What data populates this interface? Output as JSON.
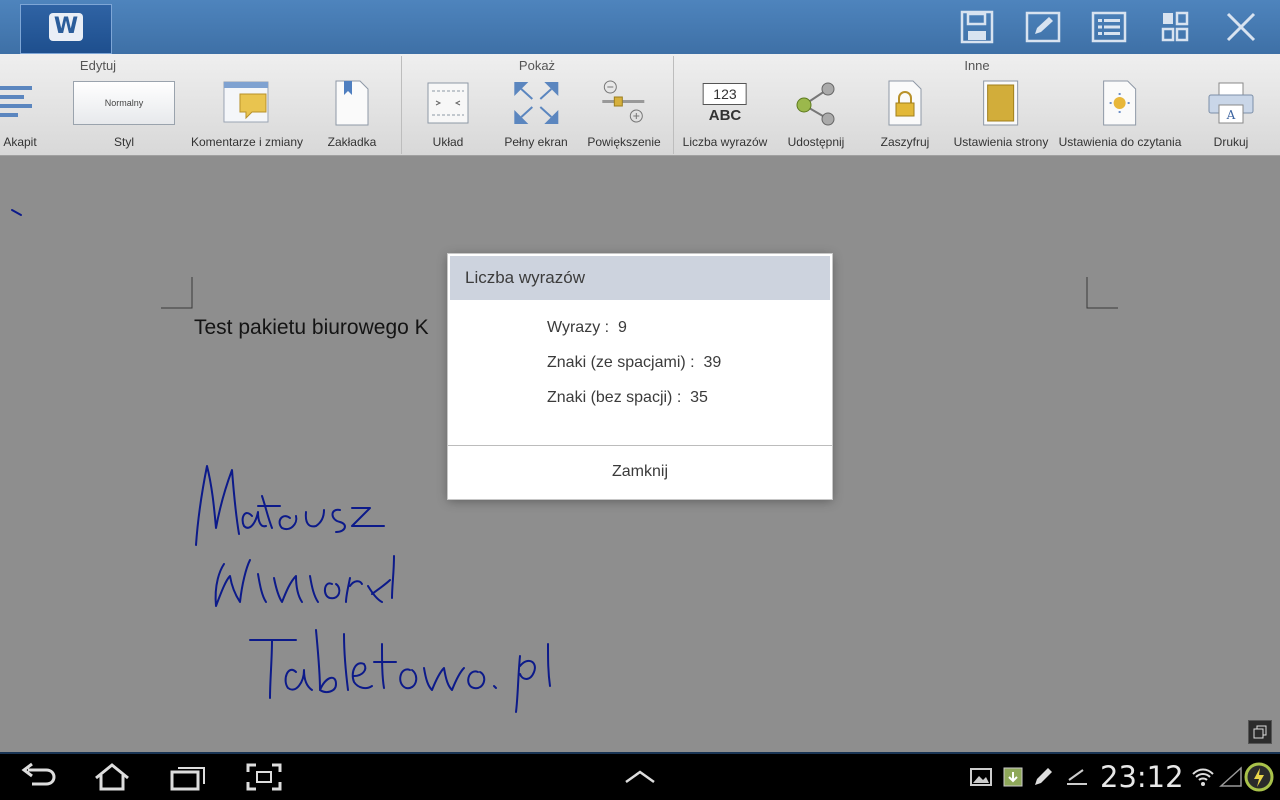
{
  "app_bar": {
    "logo_letter": "W",
    "actions": [
      "save-icon",
      "edit-icon",
      "list-icon",
      "grid-icon",
      "close-icon"
    ]
  },
  "ribbon": {
    "groups": {
      "edit": "Edytuj",
      "show": "Pokaż",
      "other": "Inne"
    },
    "items": {
      "paragraph": "Akapit",
      "style": "Styl",
      "style_value": "Normalny",
      "comments": "Komentarze i zmiany",
      "bookmark": "Zakładka",
      "layout": "Układ",
      "fullscreen": "Pełny ekran",
      "zoom": "Powiększenie",
      "word_count": "Liczba wyrazów",
      "word_count_icon_top": "123",
      "word_count_icon_bottom": "ABC",
      "share": "Udostępnij",
      "encrypt": "Zaszyfruj",
      "page_settings": "Ustawienia strony",
      "reading_settings": "Ustawienia do czytania",
      "print": "Drukuj"
    }
  },
  "document": {
    "text": "Test pakietu biurowego K"
  },
  "dialog": {
    "title": "Liczba wyrazów",
    "stats": [
      "Wyrazy :  9",
      "Znaki (ze spacjami) :  39",
      "Znaki (bez spacji) :  35"
    ],
    "close_label": "Zamknij"
  },
  "system_bar": {
    "clock": "23:12",
    "colors": {
      "background": "#000000",
      "accent": "#3e70a6"
    }
  }
}
